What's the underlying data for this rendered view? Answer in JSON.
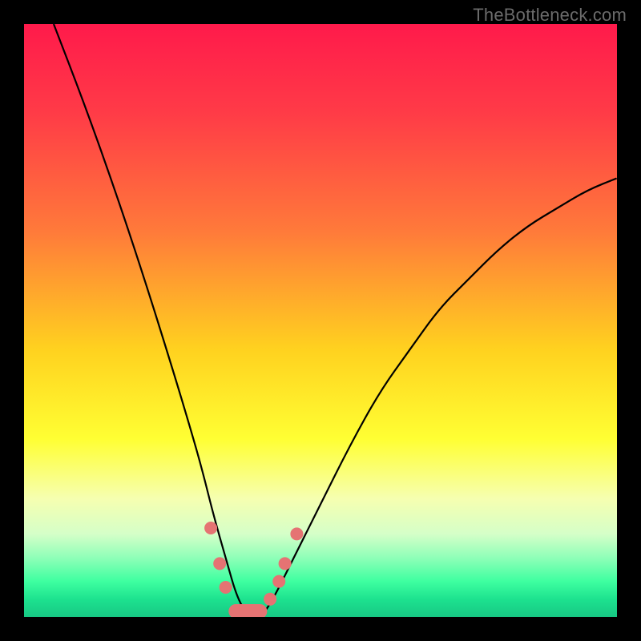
{
  "watermark": "TheBottleneck.com",
  "chart_data": {
    "type": "line",
    "title": "",
    "xlabel": "",
    "ylabel": "",
    "xlim": [
      0,
      100
    ],
    "ylim": [
      0,
      100
    ],
    "grid": false,
    "legend": false,
    "gradient_stops": [
      {
        "offset": 0.0,
        "color": "#ff1a4b"
      },
      {
        "offset": 0.15,
        "color": "#ff3b47"
      },
      {
        "offset": 0.35,
        "color": "#ff7a3a"
      },
      {
        "offset": 0.55,
        "color": "#ffd21f"
      },
      {
        "offset": 0.7,
        "color": "#ffff33"
      },
      {
        "offset": 0.8,
        "color": "#f6ffb0"
      },
      {
        "offset": 0.86,
        "color": "#d5ffc8"
      },
      {
        "offset": 0.9,
        "color": "#8fffb8"
      },
      {
        "offset": 0.94,
        "color": "#3effa0"
      },
      {
        "offset": 0.97,
        "color": "#1de28f"
      },
      {
        "offset": 1.0,
        "color": "#17c884"
      }
    ],
    "series": [
      {
        "name": "bottleneck-curve",
        "comment": "V-shaped curve; values are approximate % bottleneck vs. a normalized x-axis (0–100). Minimum near x≈37 at y≈0.",
        "x": [
          5,
          10,
          15,
          20,
          25,
          28,
          30,
          32,
          34,
          36,
          38,
          40,
          42,
          45,
          50,
          55,
          60,
          65,
          70,
          75,
          80,
          85,
          90,
          95,
          100
        ],
        "y": [
          100,
          87,
          73,
          58,
          42,
          32,
          25,
          17,
          10,
          3,
          0,
          0,
          3,
          9,
          19,
          29,
          38,
          45,
          52,
          57,
          62,
          66,
          69,
          72,
          74
        ]
      }
    ],
    "markers": {
      "comment": "salmon dots/pill along the valley floor",
      "color": "#e57373",
      "points": [
        {
          "x": 31.5,
          "y": 15
        },
        {
          "x": 33.0,
          "y": 9
        },
        {
          "x": 34.0,
          "y": 5
        },
        {
          "x": 41.5,
          "y": 3
        },
        {
          "x": 43.0,
          "y": 6
        },
        {
          "x": 44.0,
          "y": 9
        },
        {
          "x": 46.0,
          "y": 14
        }
      ],
      "pill": {
        "x0": 34.5,
        "x1": 41.0,
        "y": 0
      }
    }
  }
}
